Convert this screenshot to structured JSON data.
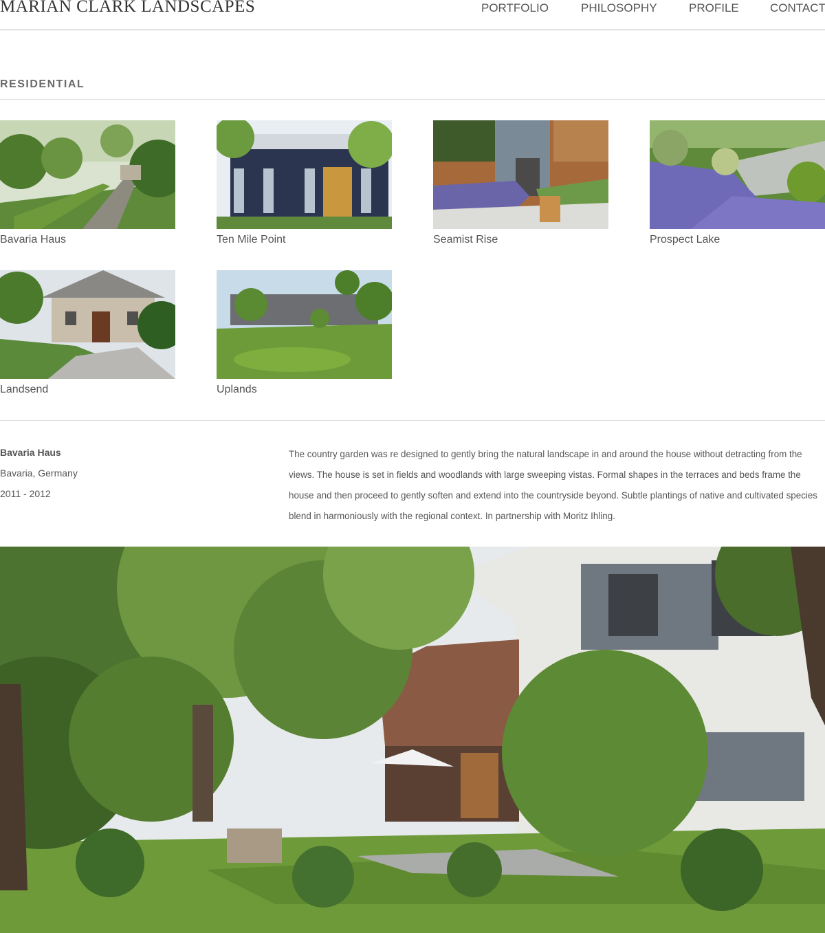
{
  "site": {
    "brand": "MARIAN CLARK LANDSCAPES"
  },
  "nav": [
    {
      "label": "PORTFOLIO"
    },
    {
      "label": "PHILOSOPHY"
    },
    {
      "label": "PROFILE"
    },
    {
      "label": "CONTACT"
    }
  ],
  "section": {
    "title": "RESIDENTIAL"
  },
  "projects": [
    {
      "title": "Bavaria Haus"
    },
    {
      "title": "Ten Mile Point"
    },
    {
      "title": "Seamist Rise"
    },
    {
      "title": "Prospect Lake"
    },
    {
      "title": "Landsend"
    },
    {
      "title": "Uplands"
    }
  ],
  "detail": {
    "name": "Bavaria Haus",
    "location": "Bavaria, Germany",
    "years": "2011 - 2012",
    "description": "The country garden was re designed to gently bring the natural landscape in and around the house without detracting from the views. The house is set in fields and woodlands with large sweeping vistas. Formal shapes in the terraces and beds frame the house and then proceed to gently soften and extend into the countryside beyond. Subtle plantings of native and cultivated species blend in harmoniously with the regional context. In partnership with Moritz Ihling."
  }
}
